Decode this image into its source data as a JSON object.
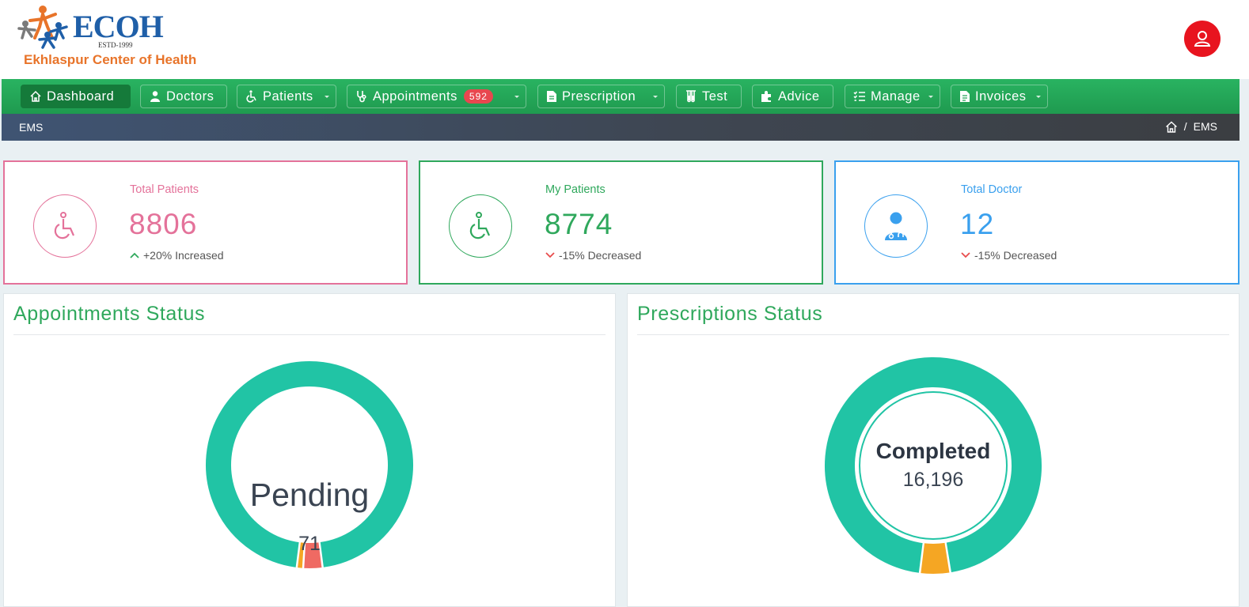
{
  "brand": {
    "name": "ECOH",
    "estd": "ESTD-1999",
    "subtitle": "Ekhlaspur Center of Health"
  },
  "nav": {
    "items": [
      {
        "label": "Dashboard",
        "icon": "home-icon",
        "active": true
      },
      {
        "label": "Doctors",
        "icon": "user-md-icon"
      },
      {
        "label": "Patients",
        "icon": "wheelchair-icon",
        "dropdown": true
      },
      {
        "label": "Appointments",
        "icon": "stethoscope-icon",
        "dropdown": true,
        "badge": "592"
      },
      {
        "label": "Prescription",
        "icon": "file-icon",
        "dropdown": true
      },
      {
        "label": "Test",
        "icon": "flask-icon"
      },
      {
        "label": "Advice",
        "icon": "puzzle-icon"
      },
      {
        "label": "Manage",
        "icon": "list-check-icon",
        "dropdown": true
      },
      {
        "label": "Invoices",
        "icon": "document-icon",
        "dropdown": true
      }
    ]
  },
  "breadcrumb": {
    "left": "EMS",
    "separator": "/",
    "current": "EMS"
  },
  "stats": [
    {
      "label": "Total Patients",
      "value": "8806",
      "trend": "+20% Increased",
      "direction": "up",
      "color": "#e4729a",
      "icon": "wheelchair-icon"
    },
    {
      "label": "My Patients",
      "value": "8774",
      "trend": "-15% Decreased",
      "direction": "down",
      "color": "#2fa85c",
      "icon": "wheelchair-icon"
    },
    {
      "label": "Total Doctor",
      "value": "12",
      "trend": "-15% Decreased",
      "direction": "down",
      "color": "#3aa0ee",
      "icon": "doctor-icon"
    }
  ],
  "panels": {
    "appointments": {
      "title": "Appointments Status",
      "center_label": "Pending",
      "center_value": "71"
    },
    "prescriptions": {
      "title": "Prescriptions Status",
      "center_label": "Completed",
      "center_value": "16,196"
    }
  },
  "chart_data": [
    {
      "type": "pie",
      "title": "Appointments Status",
      "slices": [
        {
          "color": "#21c4a5",
          "fraction": 0.96
        },
        {
          "color": "#ef6a63",
          "fraction": 0.03
        },
        {
          "color": "#f5a623",
          "fraction": 0.01
        }
      ]
    },
    {
      "type": "pie",
      "title": "Prescriptions Status",
      "slices": [
        {
          "color": "#21c4a5",
          "fraction": 0.955
        },
        {
          "color": "#f5a623",
          "fraction": 0.045
        }
      ]
    }
  ],
  "colors": {
    "nav_green": "#23a457",
    "accent_green": "#2fa85c",
    "pink": "#e4729a",
    "blue": "#3aa0ee",
    "teal": "#21c4a5",
    "red": "#ef6a63",
    "orange": "#f5a623",
    "user_red": "#e8141f"
  }
}
